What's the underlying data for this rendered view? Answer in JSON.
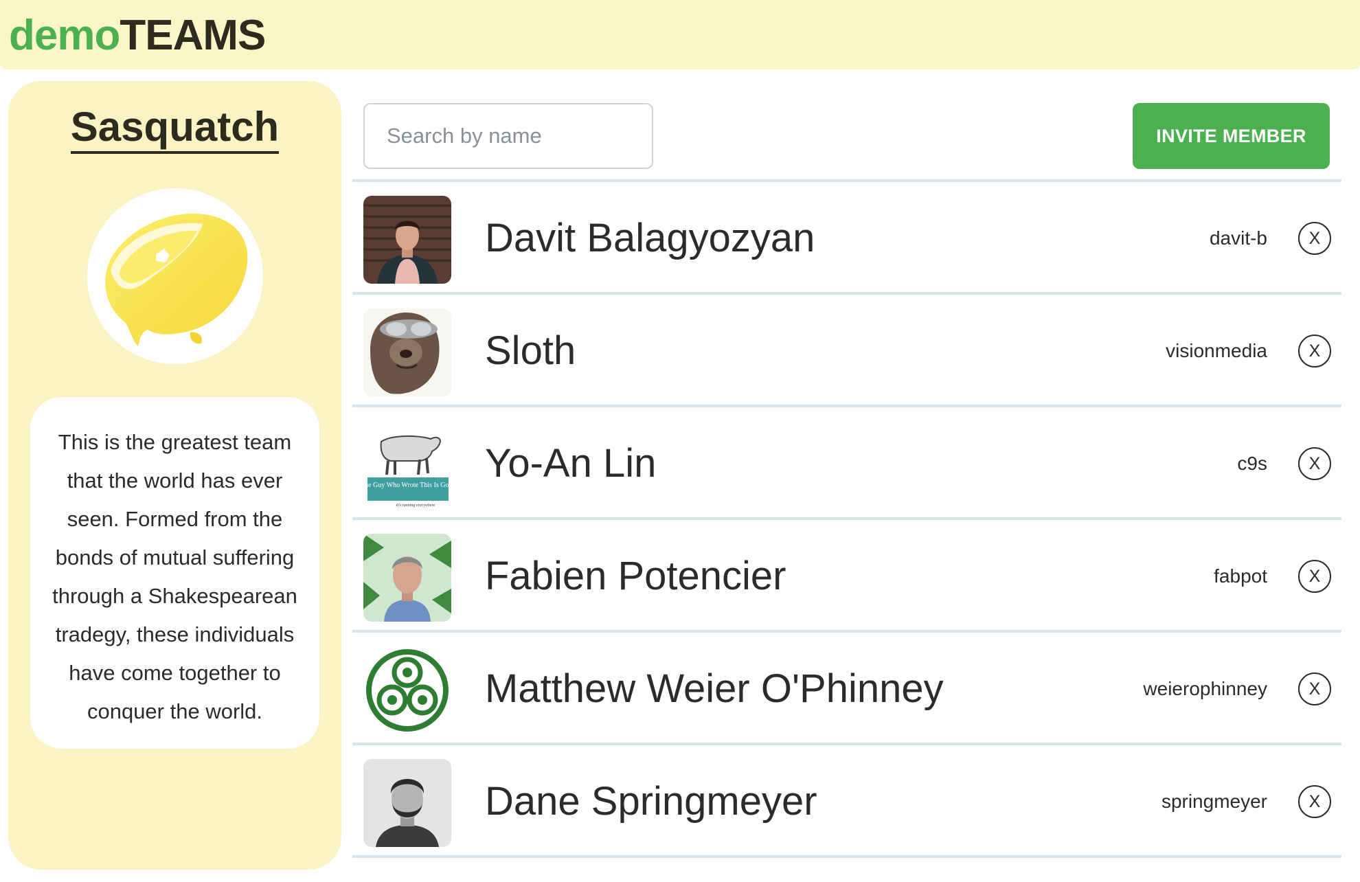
{
  "header": {
    "logo_part1": "demo",
    "logo_part2": "TEAMS"
  },
  "team": {
    "name": "Sasquatch",
    "description": "This is the greatest team that the world has ever seen. Formed from the bonds of mutual suffering through a Shakespearean tradegy, these individuals have come together to conquer the world."
  },
  "toolbar": {
    "search_placeholder": "Search by name",
    "invite_label": "INVITE MEMBER"
  },
  "members": [
    {
      "name": "Davit Balagyozyan",
      "username": "davit-b",
      "remove_label": "X"
    },
    {
      "name": "Sloth",
      "username": "visionmedia",
      "remove_label": "X"
    },
    {
      "name": "Yo-An Lin",
      "username": "c9s",
      "remove_label": "X",
      "avatar_caption": "The Guy Who Wrote This Is Gone",
      "avatar_subcaption": "It's running everywhere"
    },
    {
      "name": "Fabien Potencier",
      "username": "fabpot",
      "remove_label": "X"
    },
    {
      "name": "Matthew Weier O'Phinney",
      "username": "weierophinney",
      "remove_label": "X"
    },
    {
      "name": "Dane Springmeyer",
      "username": "springmeyer",
      "remove_label": "X"
    }
  ],
  "colors": {
    "brand_green": "#4caf50",
    "sidebar_bg": "#faf4c4",
    "header_bg": "#faf6c8"
  }
}
